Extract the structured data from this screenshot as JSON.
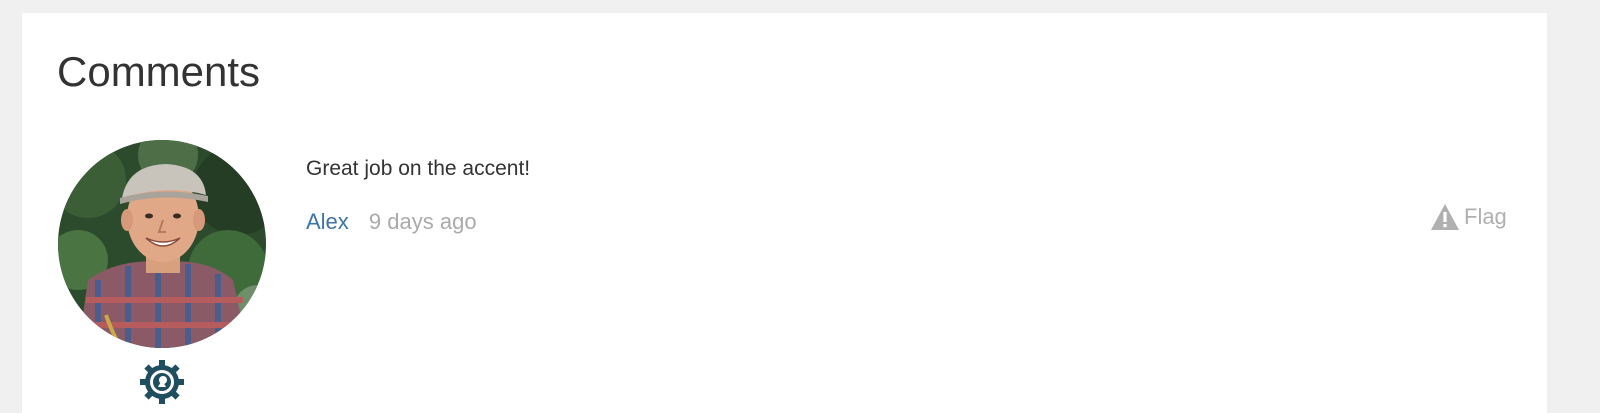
{
  "section": {
    "title": "Comments"
  },
  "comments": [
    {
      "text": "Great job on the accent!",
      "author": "Alex",
      "time": "9 days ago",
      "flag_label": "Flag",
      "avatar_icon": "user-photo",
      "badge_icon": "gear-badge-icon",
      "flag_icon": "warning-triangle-icon"
    }
  ],
  "colors": {
    "page_bg": "#f0f0f0",
    "card_bg": "#ffffff",
    "heading": "#333333",
    "author_link": "#3d75a6",
    "muted": "#aaaaaa",
    "badge": "#1f4e5f"
  }
}
